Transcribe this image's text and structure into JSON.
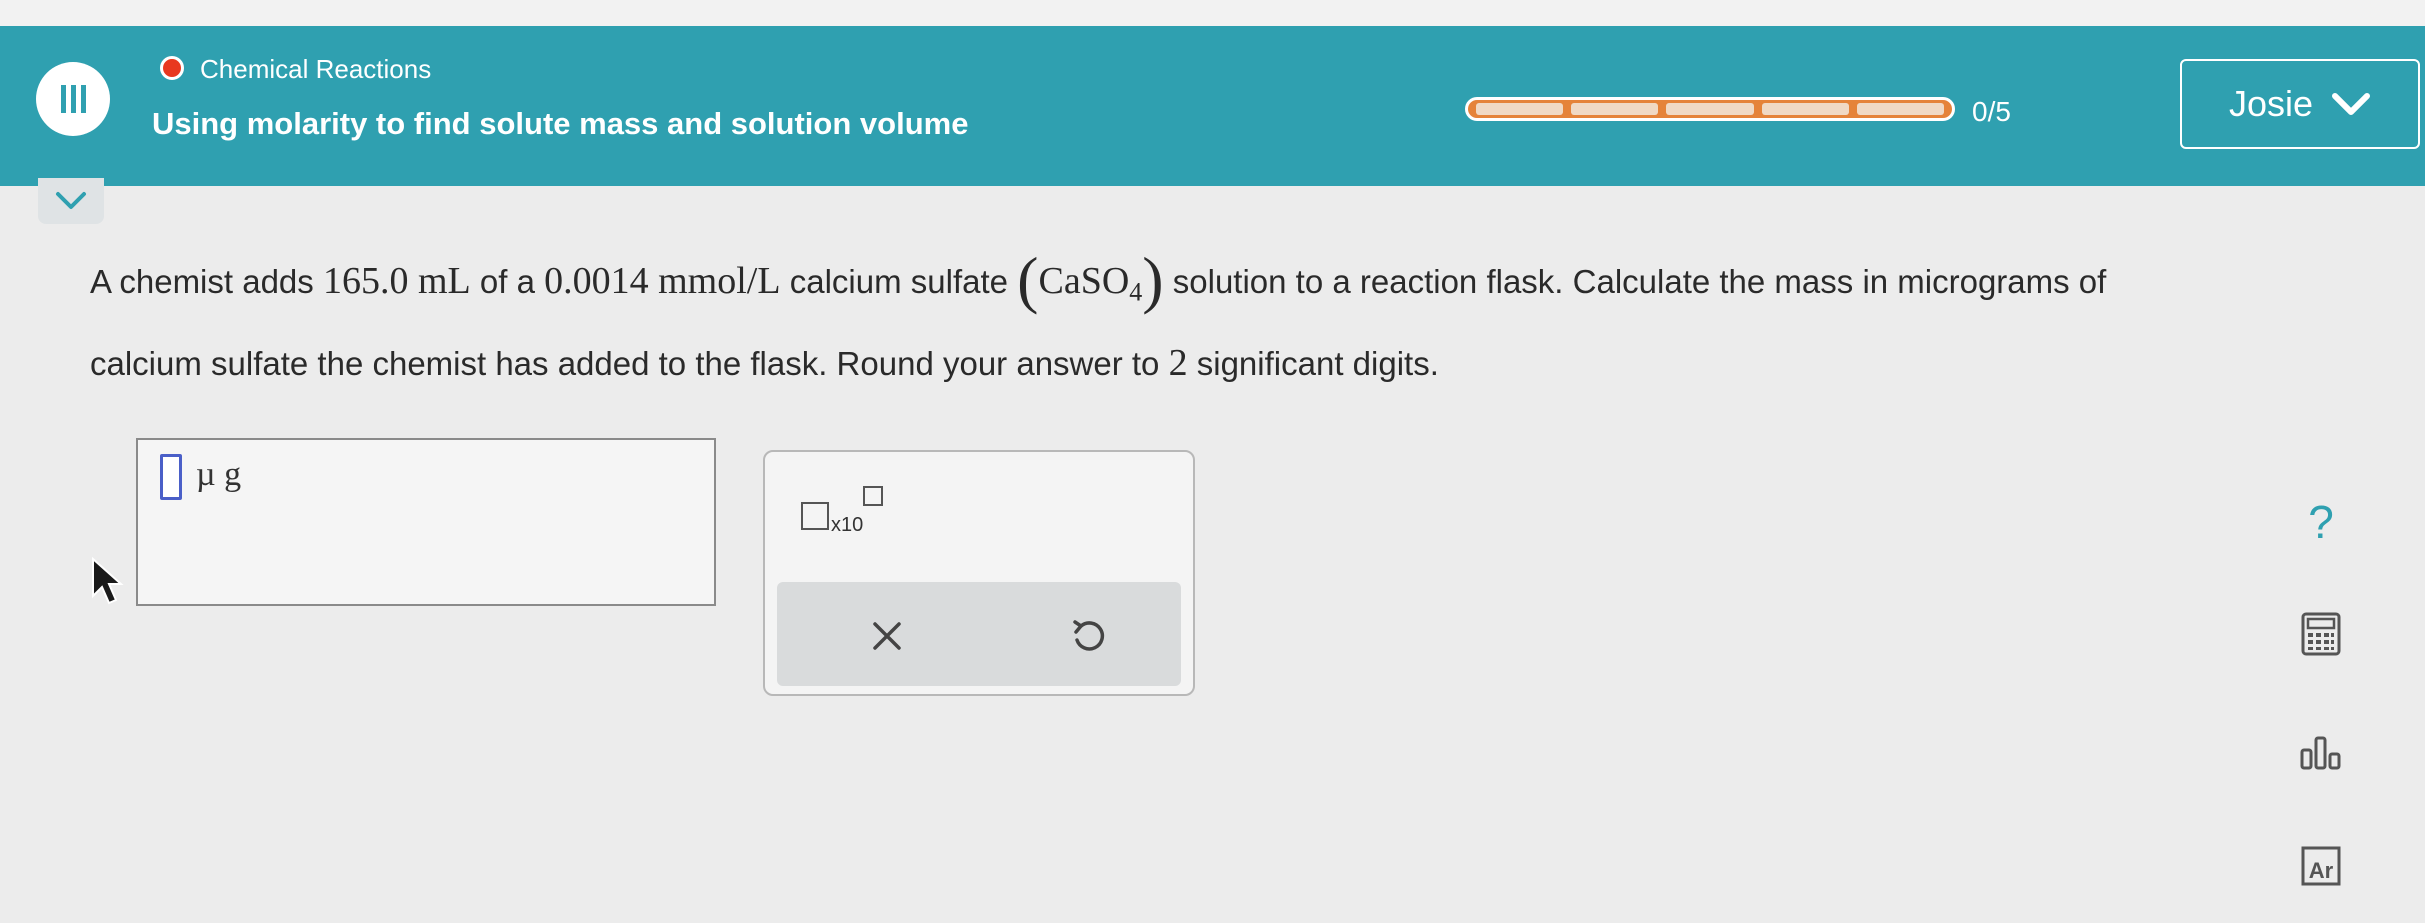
{
  "header": {
    "topic": "Chemical Reactions",
    "subtitle": "Using molarity to find solute mass and solution volume",
    "progress": {
      "completed": 0,
      "total": 5,
      "label": "0/5"
    },
    "user_name": "Josie",
    "colors": {
      "bar": "#2fa0b0",
      "topic_dot": "#e8381f",
      "progress_fill": "#e5833a"
    }
  },
  "question": {
    "t1": "A chemist adds ",
    "m1": "165.0 mL",
    "t2": " of a ",
    "m2": "0.0014  mmol/L",
    "t3": " calcium sulfate ",
    "p_open": "(",
    "formula_main": "CaSO",
    "formula_sub": "4",
    "p_close": ")",
    "t4": " solution to a reaction flask. Calculate the mass in micrograms of calcium sulfate the chemist has added to the flask. Round your answer to ",
    "m3": "2",
    "t5": " significant digits."
  },
  "answer": {
    "value": "",
    "unit": "µ g"
  },
  "tools": {
    "sci_label": "x10",
    "clear_icon": "close-icon",
    "undo_icon": "undo-icon"
  },
  "sidebar_icons": [
    "help-icon",
    "calculator-icon",
    "chart-icon",
    "periodic-table-icon"
  ],
  "sidebar_labels": {
    "help": "?",
    "periodic": "Ar"
  }
}
